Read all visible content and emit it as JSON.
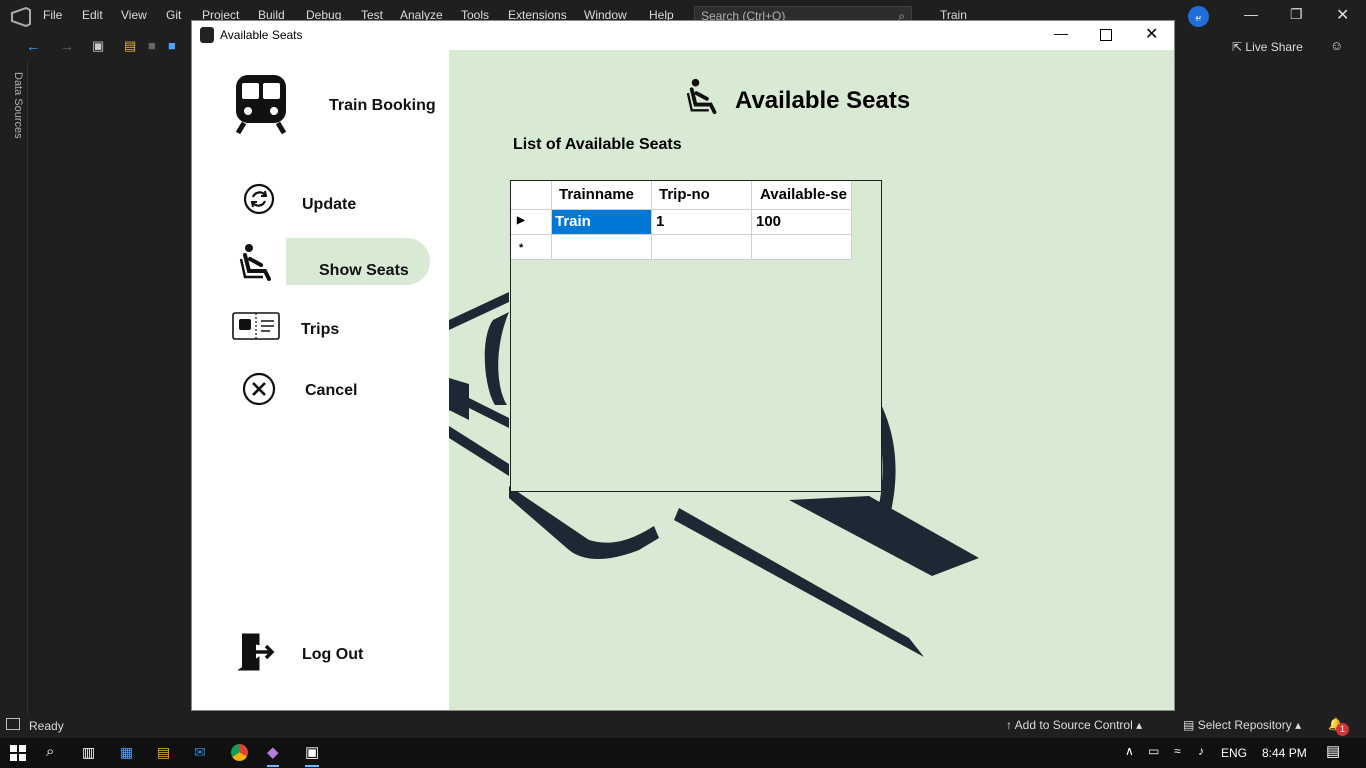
{
  "vs": {
    "menu": [
      "File",
      "Edit",
      "View",
      "Git",
      "Project",
      "Build",
      "Debug",
      "Test",
      "Analyze",
      "Tools",
      "Extensions",
      "Window",
      "Help"
    ],
    "search_placeholder": "Search (Ctrl+Q)",
    "solution_name": "Train",
    "user_badge": "ﺑﻴ",
    "live_share": "Live Share",
    "data_sources": "Data Sources",
    "status_ready": "Ready",
    "add_source_control": "Add to Source Control",
    "select_repository": "Select Repository",
    "notification_count": "1"
  },
  "taskbar": {
    "language": "ENG",
    "time": "8:44 PM"
  },
  "window": {
    "title": "Available Seats"
  },
  "sidebar": {
    "brand": "Train Booking",
    "items": [
      {
        "label": "Update",
        "icon": "refresh-icon"
      },
      {
        "label": "Show Seats",
        "icon": "seat-icon",
        "active": true
      },
      {
        "label": "Trips",
        "icon": "ticket-icon"
      },
      {
        "label": "Cancel",
        "icon": "cancel-icon"
      }
    ],
    "logout": "Log Out"
  },
  "main": {
    "heading": "Available Seats",
    "subheading": "List of Available Seats",
    "grid": {
      "columns": [
        "Trainname",
        "Trip-no",
        "Available-se"
      ],
      "rows": [
        [
          "Train",
          "1",
          "100"
        ]
      ],
      "new_row_marker": "*"
    }
  },
  "colors": {
    "content_bg": "#d8e9d4",
    "active_nav_bg": "#d8e9d4",
    "selection": "#0078d7",
    "train_art": "#1c2833"
  }
}
